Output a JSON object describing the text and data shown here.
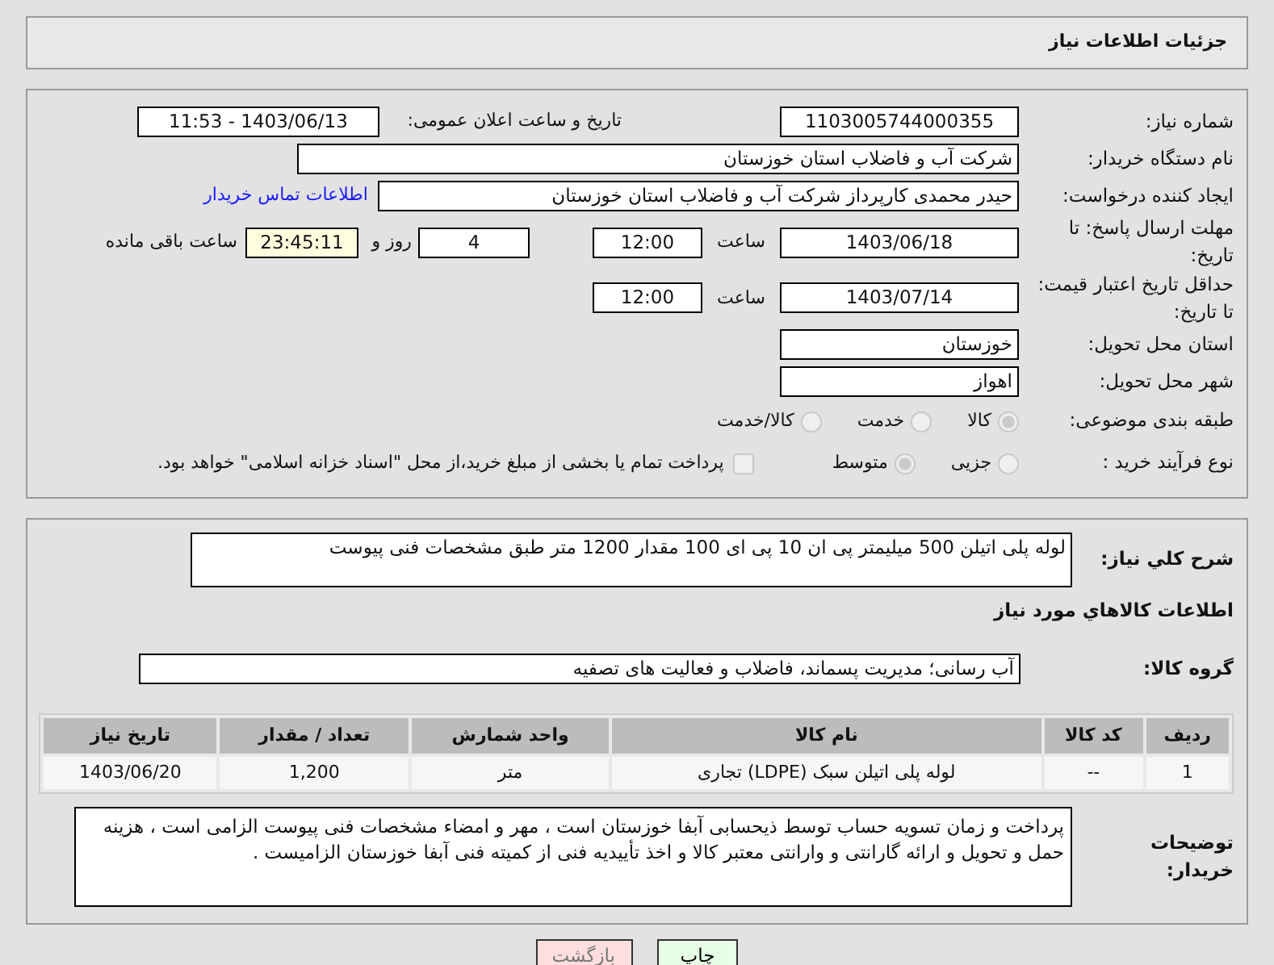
{
  "header": {
    "title": "جزئیات اطلاعات نیاز"
  },
  "need_info": {
    "need_number": {
      "label": "شماره نیاز:",
      "value": "1103005744000355"
    },
    "announce": {
      "label": "تاریخ و ساعت اعلان عمومی:",
      "value": "1403/06/13 - 11:53"
    },
    "buyer_org": {
      "label": "نام دستگاه خریدار:",
      "value": "شرکت آب و فاضلاب استان خوزستان"
    },
    "requester": {
      "label": "ایجاد کننده درخواست:",
      "value": "حیدر محمدی کارپرداز شرکت آب و فاضلاب استان خوزستان",
      "link": "اطلاعات تماس خریدار"
    },
    "reply_deadline": {
      "label": "مهلت ارسال پاسخ: تا تاریخ:",
      "date": "1403/06/18",
      "time_label": "ساعت",
      "time": "12:00",
      "days": "4",
      "days_label": "روز و",
      "remaining": "23:45:11",
      "remaining_label": "ساعت باقی مانده"
    },
    "price_validity": {
      "label": "حداقل تاریخ اعتبار قیمت: تا تاریخ:",
      "date": "1403/07/14",
      "time_label": "ساعت",
      "time": "12:00"
    },
    "province": {
      "label": "استان محل تحویل:",
      "value": "خوزستان"
    },
    "city": {
      "label": "شهر محل تحویل:",
      "value": "اهواز"
    },
    "category": {
      "label": "طبقه بندی موضوعی:",
      "options": [
        {
          "label": "کالا",
          "selected": true
        },
        {
          "label": "خدمت",
          "selected": false
        },
        {
          "label": "کالا/خدمت",
          "selected": false
        }
      ]
    },
    "process": {
      "label": "نوع فرآیند خرید :",
      "options": [
        {
          "label": "جزیی",
          "selected": false
        },
        {
          "label": "متوسط",
          "selected": true
        }
      ],
      "treasury": {
        "label": "پرداخت تمام یا بخشی از مبلغ خرید،از محل \"اسناد خزانه اسلامی\" خواهد بود.",
        "checked": false
      }
    }
  },
  "description": {
    "label": "شرح کلي نياز:",
    "value": "لوله پلی اتیلن 500 میلیمتر پی ان 10 پی ای 100 مقدار  1200 متر طبق مشخصات فنی پیوست"
  },
  "goods": {
    "title": "اطلاعات كالاهاي مورد نياز",
    "group": {
      "label": "گروه کالا:",
      "value": "آب رسانی؛ مدیریت پسماند، فاضلاب و فعالیت های تصفیه"
    },
    "table": {
      "columns": [
        "ردیف",
        "کد کالا",
        "نام کالا",
        "واحد شمارش",
        "تعداد / مقدار",
        "تاریخ نیاز"
      ],
      "rows": [
        [
          "1",
          "--",
          "لوله پلی اتیلن سبک (LDPE) تجاری",
          "متر",
          "1,200",
          "1403/06/20"
        ]
      ]
    }
  },
  "buyer_notes": {
    "label": "توضیحات خریدار:",
    "value": "پرداخت و زمان تسویه حساب توسط ذیحسابی آبفا خوزستان است ، مهر و امضاء مشخصات فنی پیوست الزامی است ، هزینه حمل و تحویل و ارائه گارانتی و وارانتی معتبر کالا و اخذ تأییدیه فنی از کمیته فنی آبفا خوزستان الزامیست ."
  },
  "buttons": [
    {
      "label": "چاپ",
      "kind": "print"
    },
    {
      "label": "بازگشت",
      "kind": "back"
    }
  ]
}
